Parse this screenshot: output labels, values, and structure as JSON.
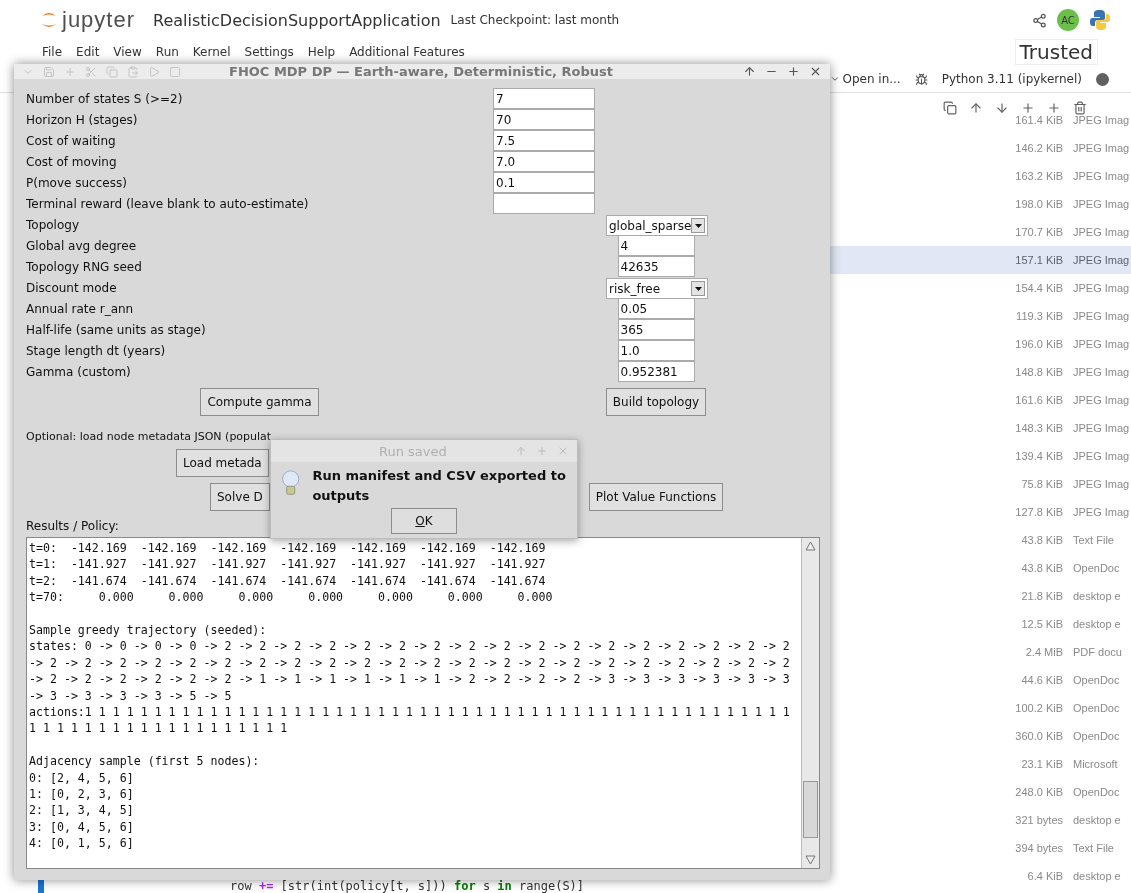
{
  "header": {
    "logo": "jupyter",
    "title": "RealisticDecisionSupportApplication",
    "checkpoint": "Last Checkpoint: last month",
    "avatar": "AC"
  },
  "menu": [
    "File",
    "Edit",
    "View",
    "Run",
    "Kernel",
    "Settings",
    "Help",
    "Additional Features"
  ],
  "trusted": "Trusted",
  "toolbar": {
    "open_in": "Open in...",
    "kernel": "Python 3.11 (ipykernel)"
  },
  "file_list": [
    {
      "size": "161.4 KiB",
      "type": "JPEG Imag",
      "selected": false
    },
    {
      "size": "146.2 KiB",
      "type": "JPEG Imag",
      "selected": false
    },
    {
      "size": "163.2 KiB",
      "type": "JPEG Imag",
      "selected": false
    },
    {
      "size": "198.0 KiB",
      "type": "JPEG Imag",
      "selected": false
    },
    {
      "size": "170.7 KiB",
      "type": "JPEG Imag",
      "selected": false
    },
    {
      "size": "157.1 KiB",
      "type": "JPEG Imag",
      "selected": true
    },
    {
      "size": "154.4 KiB",
      "type": "JPEG Imag",
      "selected": false
    },
    {
      "size": "119.3 KiB",
      "type": "JPEG Imag",
      "selected": false
    },
    {
      "size": "196.0 KiB",
      "type": "JPEG Imag",
      "selected": false
    },
    {
      "size": "148.8 KiB",
      "type": "JPEG Imag",
      "selected": false
    },
    {
      "size": "161.6 KiB",
      "type": "JPEG Imag",
      "selected": false
    },
    {
      "size": "148.3 KiB",
      "type": "JPEG Imag",
      "selected": false
    },
    {
      "size": "139.4 KiB",
      "type": "JPEG Imag",
      "selected": false
    },
    {
      "size": "75.8 KiB",
      "type": "JPEG Imag",
      "selected": false
    },
    {
      "size": "127.8 KiB",
      "type": "JPEG Imag",
      "selected": false
    },
    {
      "size": "43.8 KiB",
      "type": "Text File",
      "selected": false
    },
    {
      "size": "43.8 KiB",
      "type": "OpenDoc",
      "selected": false
    },
    {
      "size": "21.8 KiB",
      "type": "desktop e",
      "selected": false
    },
    {
      "size": "12.5 KiB",
      "type": "desktop e",
      "selected": false
    },
    {
      "size": "2.4 MiB",
      "type": "PDF docu",
      "selected": false
    },
    {
      "size": "44.6 KiB",
      "type": "OpenDoc",
      "selected": false
    },
    {
      "size": "100.2 KiB",
      "type": "OpenDoc",
      "selected": false
    },
    {
      "size": "360.0 KiB",
      "type": "OpenDoc",
      "selected": false
    },
    {
      "size": "23.1 KiB",
      "type": "Microsoft",
      "selected": false
    },
    {
      "size": "248.0 KiB",
      "type": "OpenDoc",
      "selected": false
    },
    {
      "size": "321 bytes",
      "type": "desktop e",
      "selected": false
    },
    {
      "size": "394 bytes",
      "type": "Text File",
      "selected": false
    },
    {
      "size": "6.4 KiB",
      "type": "desktop e",
      "selected": false
    }
  ],
  "code_line": [
    {
      "text": "row ",
      "kind": "plain"
    },
    {
      "text": "+=",
      "kind": "operator"
    },
    {
      "text": " [str(int(policy[t, s])) ",
      "kind": "plain"
    },
    {
      "text": "for",
      "kind": "keyword"
    },
    {
      "text": " s ",
      "kind": "plain"
    },
    {
      "text": "in",
      "kind": "keyword"
    },
    {
      "text": " range(S)]",
      "kind": "plain"
    }
  ],
  "app_window": {
    "title": "FHOC MDP DP — Earth-aware, Deterministic, Robust",
    "fields": [
      {
        "label": "Number of states S (>=2)",
        "value": "7",
        "kind": "entry"
      },
      {
        "label": "Horizon H (stages)",
        "value": "70",
        "kind": "entry"
      },
      {
        "label": "Cost of waiting",
        "value": "7.5",
        "kind": "entry"
      },
      {
        "label": "Cost of moving",
        "value": "7.0",
        "kind": "entry"
      },
      {
        "label": "P(move success)",
        "value": "0.1",
        "kind": "entry"
      },
      {
        "label": "Terminal reward (leave blank to auto-estimate)",
        "kind": "entry"
      },
      {
        "label": "Topology",
        "value": "global_sparse",
        "kind": "dropdown"
      },
      {
        "label": "Global avg degree",
        "value": "4",
        "kind": "short_entry"
      },
      {
        "label": "Topology RNG seed",
        "value": "42635",
        "kind": "short_entry"
      },
      {
        "label": "Discount mode",
        "value": "risk_free",
        "kind": "dropdown"
      },
      {
        "label": "Annual rate r_ann",
        "value": "0.05",
        "kind": "short_entry"
      },
      {
        "label": "Half-life (same units as stage)",
        "value": "365",
        "kind": "short_entry"
      },
      {
        "label": "Stage length dt (years)",
        "value": "1.0",
        "kind": "short_entry"
      },
      {
        "label": "Gamma (custom)",
        "value": "0.952381",
        "kind": "short_entry"
      }
    ],
    "compute_button": "Compute gamma",
    "topology_button": "Build topology",
    "metadata_label": "Optional: load node metadata JSON (populat",
    "load_button": "Load metada",
    "solve_button": "Solve D",
    "plot_button": "Plot Value Functions",
    "results_label": "Results / Policy:",
    "output_blocks": [
      [
        "t=0:  -142.169  -142.169  -142.169  -142.169  -142.169  -142.169  -142.169",
        "t=1:  -141.927  -141.927  -141.927  -141.927  -141.927  -141.927  -141.927",
        "t=2:  -141.674  -141.674  -141.674  -141.674  -141.674  -141.674  -141.674",
        "t=70:     0.000     0.000     0.000     0.000     0.000     0.000     0.000"
      ],
      [
        "Sample greedy trajectory (seeded):",
        "states: 0 -> 0 -> 0 -> 0 -> 2 -> 2 -> 2 -> 2 -> 2 -> 2 -> 2 -> 2 -> 2 -> 2 -> 2 -> 2 -> 2 -> 2 -> 2 -> 2 -> 2",
        "-> 2 -> 2 -> 2 -> 2 -> 2 -> 2 -> 2 -> 2 -> 2 -> 2 -> 2 -> 2 -> 2 -> 2 -> 2 -> 2 -> 2 -> 2 -> 2 -> 2 -> 2 -> 2",
        "-> 2 -> 2 -> 2 -> 2 -> 2 -> 2 -> 1 -> 1 -> 1 -> 1 -> 1 -> 1 -> 2 -> 2 -> 2 -> 2 -> 3 -> 3 -> 3 -> 3 -> 3 -> 3",
        "-> 3 -> 3 -> 3 -> 3 -> 5 -> 5",
        "actions:1 1 1 1 1 1 1 1 1 1 1 1 1 1 1 1 1 1 1 1 1 1 1 1 1 1 1 1 1 1 1 1 1 1 1 1 1 1 1 1 1 1 1 1 1 1 1 1 1 1 1",
        "1 1 1 1 1 1 1 1 1 1 1 1 1 1 1 1 1 1 1"
      ],
      [
        "Adjacency sample (first 5 nodes):",
        "0: [2, 4, 5, 6]",
        "1: [0, 2, 3, 6]",
        "2: [1, 3, 4, 5]",
        "3: [0, 4, 5, 6]",
        "4: [0, 1, 5, 6]"
      ]
    ]
  },
  "dialog": {
    "title": "Run saved",
    "message": "Run manifest and CSV exported to outputs",
    "button": "OK"
  }
}
